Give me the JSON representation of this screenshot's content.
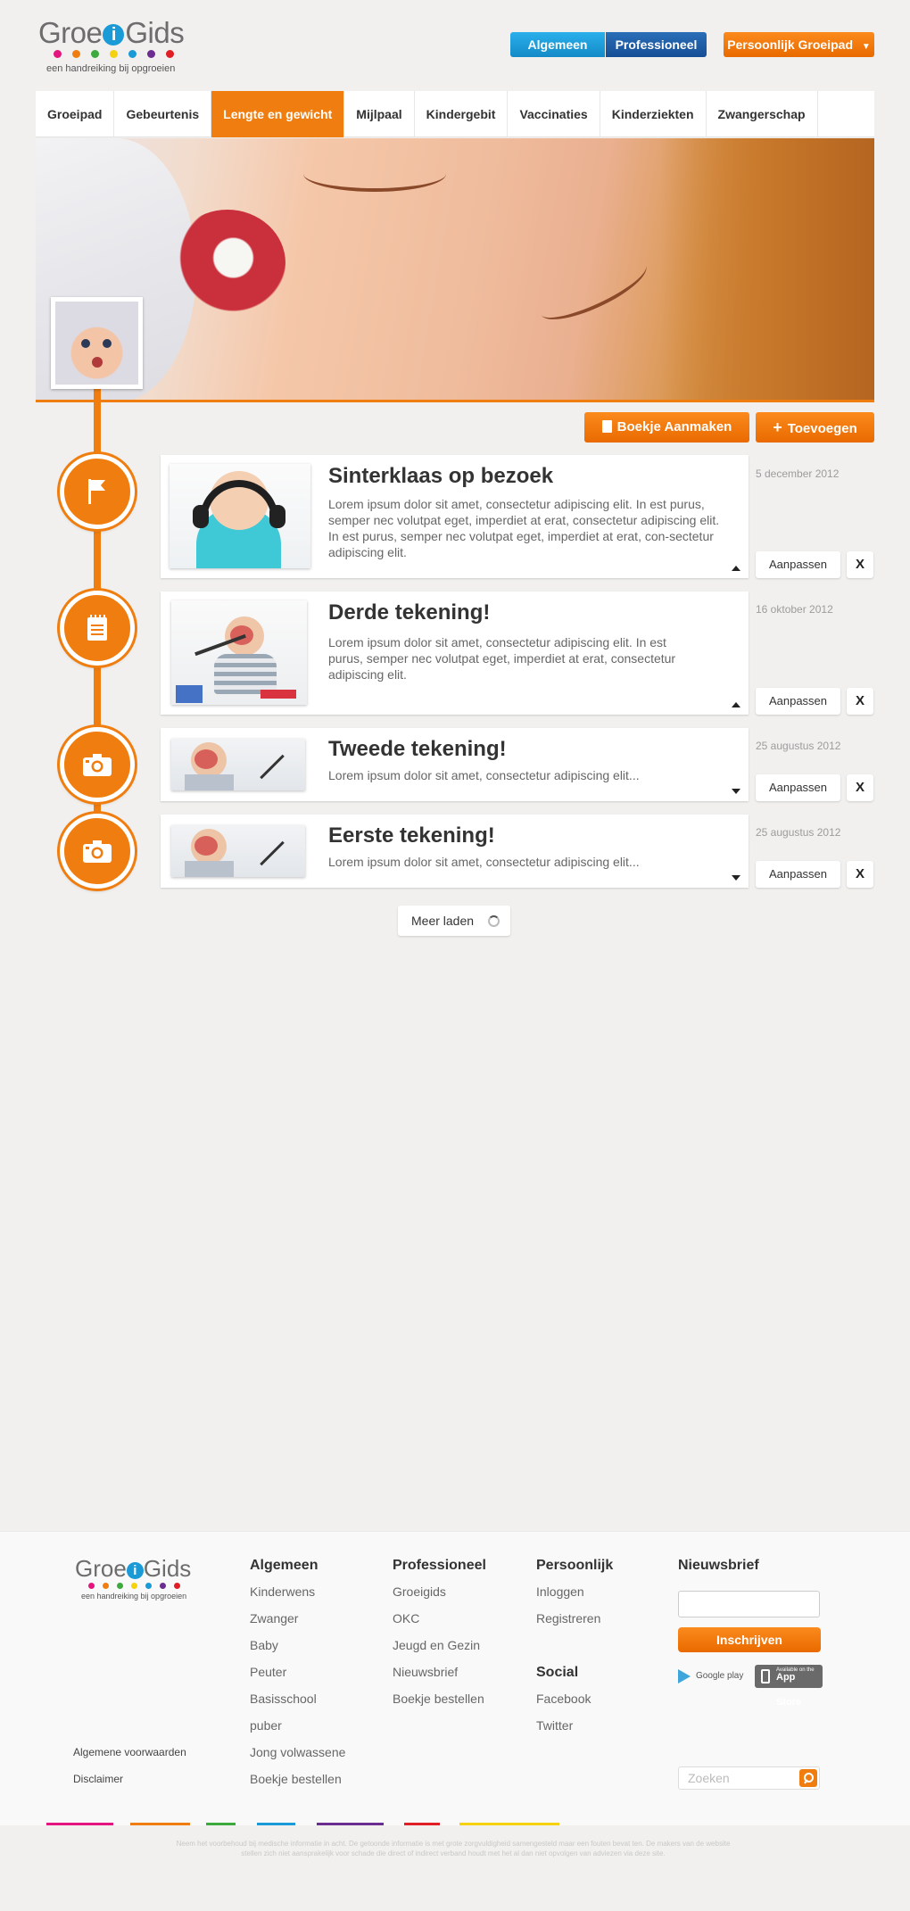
{
  "logo": {
    "word_left": "Groe",
    "word_i": "i",
    "word_right": "Gids",
    "tagline": "een handreiking bij opgroeien",
    "dot_colors": [
      "#e4157e",
      "#f07d0f",
      "#3caa3c",
      "#f6d10e",
      "#1a9ad6",
      "#6b2d8f",
      "#e01e25"
    ]
  },
  "header": {
    "algemeen": "Algemeen",
    "professioneel": "Professioneel",
    "persoonlijk": "Persoonlijk Groeipad"
  },
  "nav": {
    "items": [
      "Groeipad",
      "Gebeurtenis",
      "Lengte en gewicht",
      "Mijlpaal",
      "Kindergebit",
      "Vaccinaties",
      "Kinderziekten",
      "Zwangerschap"
    ],
    "active_index": 2
  },
  "actions": {
    "boekje": "Boekje Aanmaken",
    "toevoegen": "Toevoegen"
  },
  "timeline": [
    {
      "icon": "flag-icon",
      "title": "Sinterklaas op bezoek",
      "text": "Lorem ipsum dolor sit amet, consectetur adipiscing elit. In est purus, semper nec volutpat eget, imperdiet at erat, consectetur adipiscing elit. In est purus, semper nec volutpat eget, imperdiet at erat, con-sectetur adipiscing elit.",
      "date": "5 december 2012",
      "expanded": true
    },
    {
      "icon": "notepad-icon",
      "title": "Derde tekening!",
      "text": "Lorem ipsum dolor sit amet, consectetur adipiscing elit. In est purus, semper nec volutpat eget, imperdiet at erat, consectetur adipiscing elit.",
      "date": "16 oktober 2012",
      "expanded": true
    },
    {
      "icon": "camera-icon",
      "title": "Tweede tekening!",
      "text": "Lorem ipsum dolor sit amet, consectetur adipiscing elit...",
      "date": "25 augustus 2012",
      "expanded": false
    },
    {
      "icon": "camera-icon",
      "title": "Eerste tekening!",
      "text": "Lorem ipsum dolor sit amet, consectetur adipiscing elit...",
      "date": "25 augustus 2012",
      "expanded": false
    }
  ],
  "item_buttons": {
    "edit": "Aanpassen",
    "delete": "X"
  },
  "load_more": "Meer laden",
  "footer": {
    "col1": {
      "title": "Algemeen",
      "links": [
        "Kinderwens",
        "Zwanger",
        "Baby",
        "Peuter",
        "Basisschool",
        "puber",
        "Jong volwassene",
        "Boekje bestellen"
      ]
    },
    "col2": {
      "title": "Professioneel",
      "links": [
        "Groeigids",
        "OKC",
        "Jeugd en Gezin",
        "Nieuwsbrief",
        "Boekje bestellen"
      ]
    },
    "col3": {
      "title": "Persoonlijk",
      "links": [
        "Inloggen",
        "Registreren"
      ]
    },
    "social": {
      "title": "Social",
      "links": [
        "Facebook",
        "Twitter"
      ]
    },
    "newsletter": {
      "title": "Nieuwsbrief",
      "button": "Inschrijven"
    },
    "google_play": "Google play",
    "app_store": "App Store",
    "app_store_sub": "Available on the",
    "search_placeholder": "Zoeken",
    "legal_links": [
      "Algemene voorwaarden",
      "Disclaimer"
    ],
    "disclaimer": "Neem het voorbehoud bij medische informatie in acht. De getoonde informatie is met grote zorgvuldigheid samengesteld maar een fouten bevat ten. De makers van de website stellen zich niet aansprakelijk voor schade die direct of indirect verband houdt met het al dan niet opvolgen van adviezen via deze site.",
    "stripe_colors": [
      "#e4157e",
      "#f07d0f",
      "#3caa3c",
      "#1a9ad6",
      "#6b2d8f",
      "#e01e25",
      "#f6d10e"
    ]
  }
}
